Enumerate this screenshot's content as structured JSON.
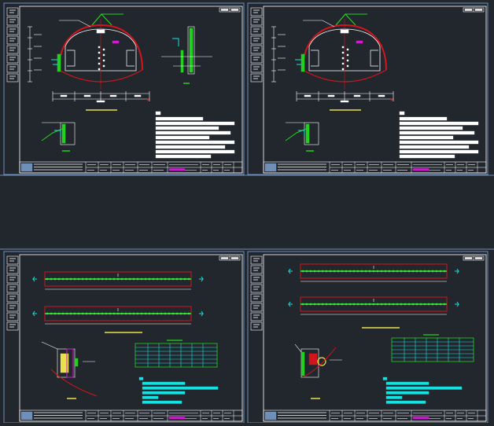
{
  "colors": {
    "background": "#22272e",
    "frame": "#6f8fb8",
    "inner_frame": "#ffffff",
    "red": "#d0161c",
    "green": "#22d11f",
    "cyan": "#19e0e0",
    "white": "#ffffff",
    "yellow": "#e8e14a",
    "magenta": "#d11ad1"
  },
  "sheets": [
    {
      "id": "sheet-1",
      "kind": "tunnel-section",
      "variant": "a"
    },
    {
      "id": "sheet-2",
      "kind": "tunnel-section",
      "variant": "b"
    },
    {
      "id": "sheet-3",
      "kind": "plan-view",
      "variant": "a"
    },
    {
      "id": "sheet-4",
      "kind": "plan-view",
      "variant": "b"
    }
  ]
}
